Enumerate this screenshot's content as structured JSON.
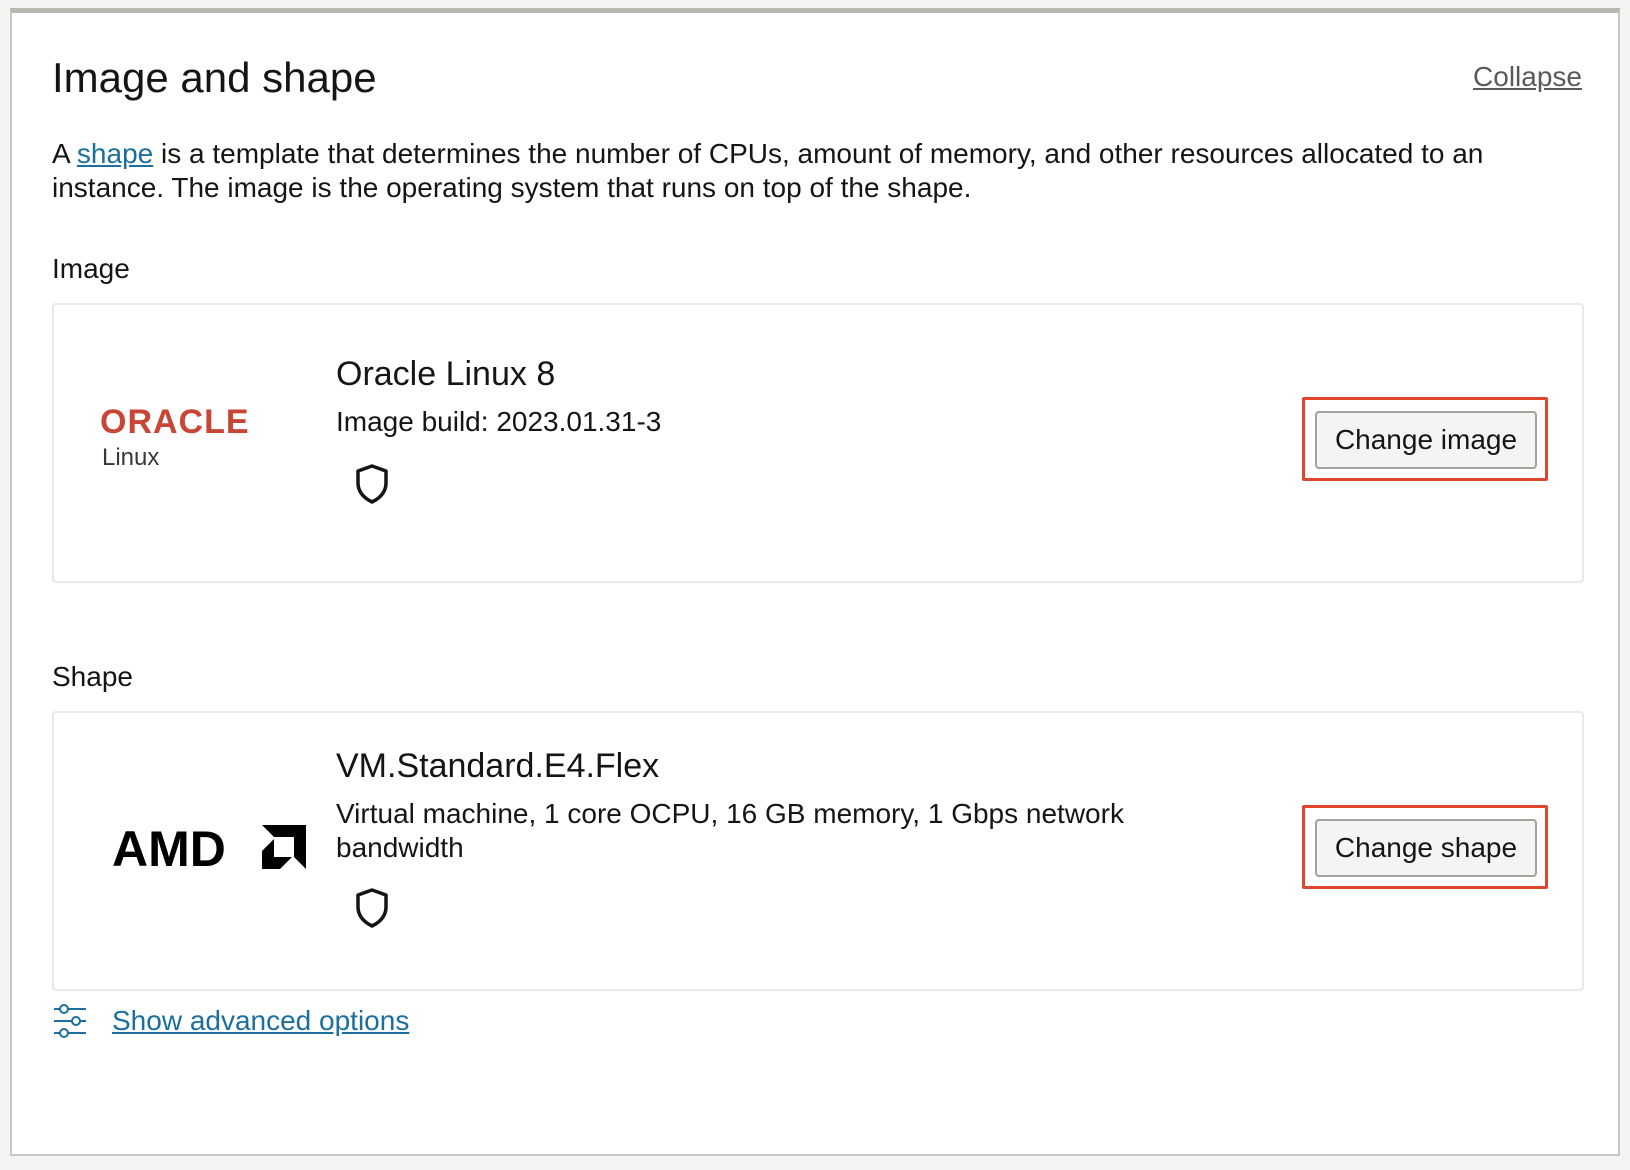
{
  "panel": {
    "title": "Image and shape",
    "collapse_label": "Collapse",
    "intro_prefix": "A ",
    "intro_link": "shape",
    "intro_suffix": " is a template that determines the number of CPUs, amount of memory, and other resources allocated to an instance. The image is the operating system that runs on top of the shape."
  },
  "image_section": {
    "label": "Image",
    "logo_brand": "ORACLE",
    "logo_sub": "Linux",
    "name": "Oracle Linux 8",
    "build": "Image build: 2023.01.31-3",
    "icon": "shield-icon",
    "button_label": "Change image"
  },
  "shape_section": {
    "label": "Shape",
    "logo_brand": "AMD",
    "name": "VM.Standard.E4.Flex",
    "description": "Virtual machine, 1 core OCPU, 16 GB memory, 1 Gbps network bandwidth",
    "icon": "shield-icon",
    "button_label": "Change shape"
  },
  "advanced": {
    "icon": "sliders-icon",
    "label": "Show advanced options"
  },
  "colors": {
    "link": "#1c6e9e",
    "highlight": "#e0452e",
    "oracle_red": "#c74634"
  }
}
